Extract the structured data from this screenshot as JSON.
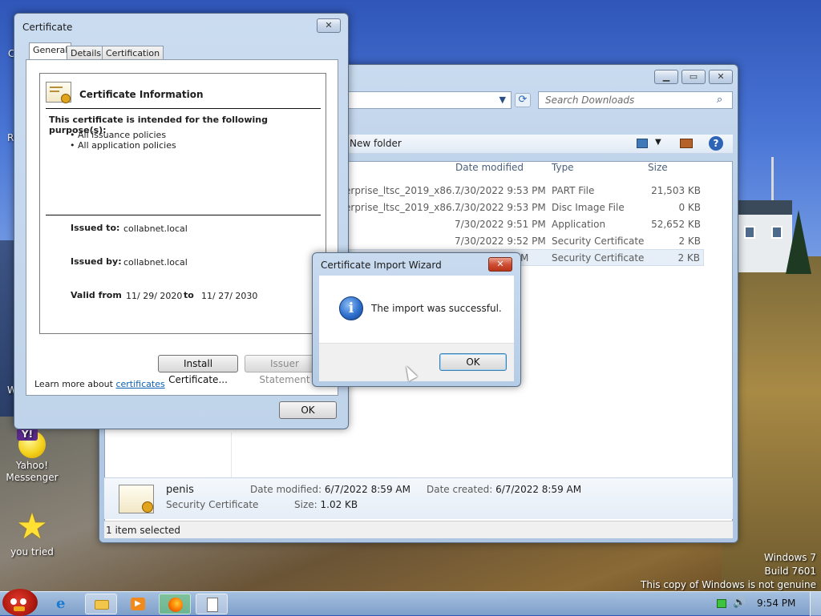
{
  "desktop": {
    "icons": [
      {
        "label_line1": "Yahoo!",
        "label_line2": "Messenger"
      },
      {
        "label": "you tried"
      }
    ],
    "edge_letters": [
      "C",
      "R",
      "W"
    ],
    "watermark": [
      "Windows 7",
      "Build 7601",
      "This copy of Windows is not genuine"
    ]
  },
  "explorer": {
    "search_placeholder": "Search Downloads",
    "toolbar": {
      "new_folder": "New folder"
    },
    "columns": {
      "date": "Date modified",
      "type": "Type",
      "size": "Size"
    },
    "rows": [
      {
        "name": "erprise_ltsc_2019_x86...",
        "date": "7/30/2022 9:53 PM",
        "type": "PART File",
        "size": "21,503 KB"
      },
      {
        "name": "erprise_ltsc_2019_x86...",
        "date": "7/30/2022 9:53 PM",
        "type": "Disc Image File",
        "size": "0 KB"
      },
      {
        "name": "",
        "date": "7/30/2022 9:51 PM",
        "type": "Application",
        "size": "52,652 KB"
      },
      {
        "name": "",
        "date": "7/30/2022 9:52 PM",
        "type": "Security Certificate",
        "size": "2 KB"
      },
      {
        "name": "",
        "date": "M",
        "type": "Security Certificate",
        "size": "2 KB"
      }
    ],
    "details": {
      "name": "penis",
      "type": "Security Certificate",
      "modified_label": "Date modified:",
      "modified_value": "6/7/2022 8:59 AM",
      "created_label": "Date created:",
      "created_value": "6/7/2022 8:59 AM",
      "size_label": "Size:",
      "size_value": "1.02 KB"
    },
    "status": "1 item selected"
  },
  "cert_dialog": {
    "title": "Certificate",
    "tabs": [
      "General",
      "Details",
      "Certification Path"
    ],
    "info_heading": "Certificate Information",
    "purpose_heading": "This certificate is intended for the following purpose(s):",
    "purposes": [
      "• All issuance policies",
      "• All application policies"
    ],
    "issued_to_label": "Issued to:",
    "issued_to": "collabnet.local",
    "issued_by_label": "Issued by:",
    "issued_by": "collabnet.local",
    "valid_from_label": "Valid from",
    "valid_from": "11/ 29/ 2020",
    "to_label": "to",
    "valid_to": "11/ 27/ 2030",
    "install_button": "Install Certificate...",
    "issuer_button": "Issuer Statement",
    "learn_more": "Learn more about",
    "learn_more_link": "certificates",
    "ok_button": "OK"
  },
  "wizard": {
    "title": "Certificate Import Wizard",
    "message": "The import was successful.",
    "ok_button": "OK"
  },
  "taskbar": {
    "clock": "9:54 PM"
  }
}
